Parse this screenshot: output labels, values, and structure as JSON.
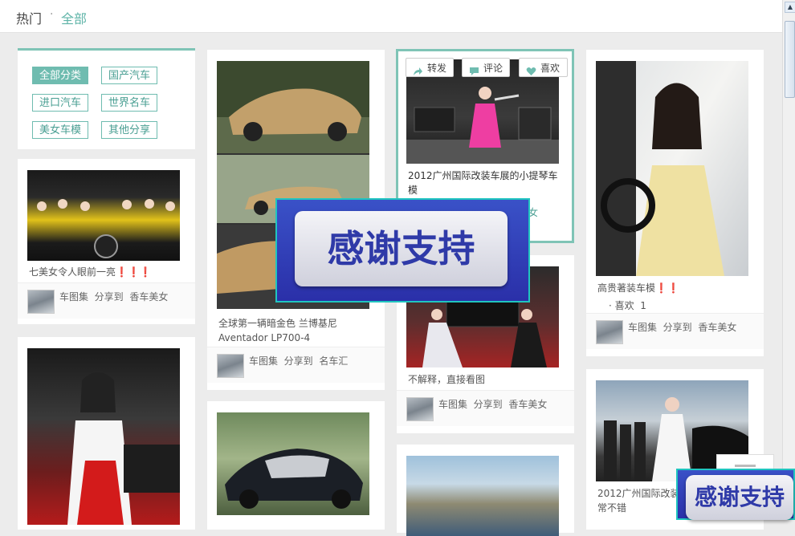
{
  "breadcrumb": {
    "home": "热门",
    "sep": "·",
    "current": "全部"
  },
  "categories": [
    {
      "label": "全部分类",
      "active": true
    },
    {
      "label": "国产汽车"
    },
    {
      "label": "进口汽车"
    },
    {
      "label": "世界名车"
    },
    {
      "label": "美女车模"
    },
    {
      "label": "其他分享"
    }
  ],
  "actions": {
    "share": "转发",
    "comment": "评论",
    "like": "喜欢"
  },
  "posts": {
    "p1": {
      "caption": "七美女令人眼前一亮❗❗❗",
      "source": "车图集",
      "shared": "分享到",
      "board": "香车美女"
    },
    "p2": {
      "caption": "全球第一辆暗金色 兰博基尼 Aventador LP700-4",
      "source": "车图集",
      "shared": "分享到",
      "board": "名车汇"
    },
    "p3": {
      "caption": "2012广州国际改装车展的小提琴车模",
      "board_partial": "美女"
    },
    "p4": {
      "caption": "不解释，直接看图",
      "source": "车图集",
      "shared": "分享到",
      "board": "香车美女"
    },
    "p5": {
      "caption": "高贵著装车模❗❗",
      "likes_label": "· 喜欢",
      "likes": "1",
      "source": "车图集",
      "shared": "分享到",
      "board": "香车美女"
    },
    "p6": {
      "caption": "2012广州国际改装",
      "caption2": "常不错"
    }
  },
  "overlay": {
    "text": "感谢支持"
  },
  "colors": {
    "accent": "#6fbcb0",
    "overlay_blue": "#2f3aa8"
  }
}
